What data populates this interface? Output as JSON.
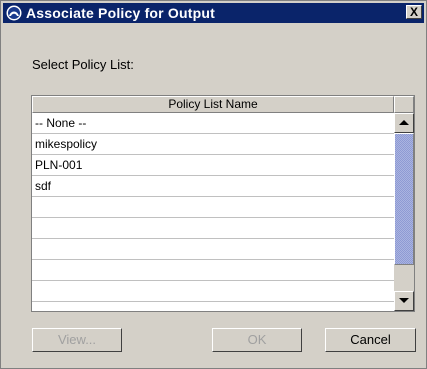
{
  "window": {
    "title": "Associate Policy for Output",
    "close_label": "X"
  },
  "prompt": "Select Policy List:",
  "table": {
    "column_header": "Policy List Name",
    "rows": [
      "-- None --",
      "mikespolicy",
      "PLN-001",
      "sdf",
      "",
      "",
      "",
      "",
      ""
    ]
  },
  "buttons": {
    "view": "View...",
    "ok": "OK",
    "cancel": "Cancel"
  },
  "colors": {
    "titlebar": "#0a246a",
    "dialog_bg": "#d4d0c8",
    "scroll_thumb": "#aab4e0"
  }
}
